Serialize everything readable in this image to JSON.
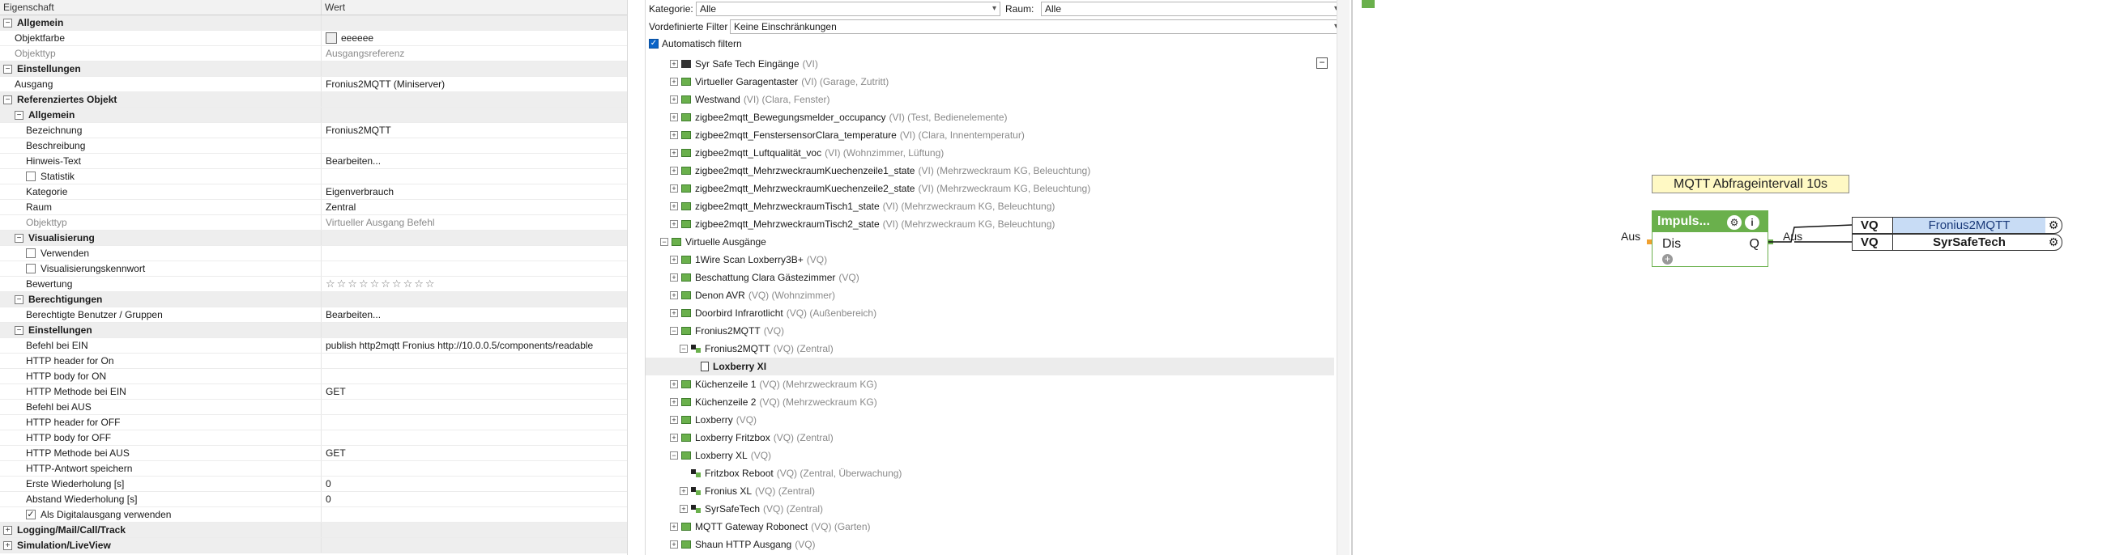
{
  "props": {
    "header": {
      "col1": "Eigenschaft",
      "col2": "Wert"
    },
    "rows": [
      {
        "kind": "cat",
        "level": 0,
        "label": "Allgemein",
        "value": ""
      },
      {
        "kind": "prop",
        "level": 1,
        "label": "Objektfarbe",
        "value": "eeeeee",
        "swatch": "#eeeeee"
      },
      {
        "kind": "prop",
        "level": 1,
        "label": "Objekttyp",
        "value": "Ausgangsreferenz",
        "dim": true
      },
      {
        "kind": "cat",
        "level": 0,
        "label": "Einstellungen",
        "value": ""
      },
      {
        "kind": "prop",
        "level": 1,
        "label": "Ausgang",
        "value": "Fronius2MQTT (Miniserver)"
      },
      {
        "kind": "cat",
        "level": 0,
        "label": "Referenziertes Objekt",
        "value": ""
      },
      {
        "kind": "cat",
        "level": 1,
        "label": "Allgemein",
        "value": ""
      },
      {
        "kind": "prop",
        "level": 2,
        "label": "Bezeichnung",
        "value": "Fronius2MQTT"
      },
      {
        "kind": "prop",
        "level": 2,
        "label": "Beschreibung",
        "value": ""
      },
      {
        "kind": "prop",
        "level": 2,
        "label": "Hinweis-Text",
        "value": "Bearbeiten..."
      },
      {
        "kind": "check",
        "level": 2,
        "label": "Statistik",
        "value": "",
        "checked": false
      },
      {
        "kind": "prop",
        "level": 2,
        "label": "Kategorie",
        "value": "Eigenverbrauch"
      },
      {
        "kind": "prop",
        "level": 2,
        "label": "Raum",
        "value": "Zentral"
      },
      {
        "kind": "prop",
        "level": 2,
        "label": "Objekttyp",
        "value": "Virtueller Ausgang Befehl",
        "dim": true
      },
      {
        "kind": "cat",
        "level": 1,
        "label": "Visualisierung",
        "value": ""
      },
      {
        "kind": "check",
        "level": 2,
        "label": "Verwenden",
        "value": "",
        "checked": false
      },
      {
        "kind": "check",
        "level": 2,
        "label": "Visualisierungskennwort",
        "value": "",
        "checked": false
      },
      {
        "kind": "prop",
        "level": 2,
        "label": "Bewertung",
        "value": "☆☆☆☆☆☆☆☆☆☆",
        "stars": true
      },
      {
        "kind": "cat",
        "level": 1,
        "label": "Berechtigungen",
        "value": ""
      },
      {
        "kind": "prop",
        "level": 2,
        "label": "Berechtigte Benutzer / Gruppen",
        "value": "Bearbeiten..."
      },
      {
        "kind": "cat",
        "level": 1,
        "label": "Einstellungen",
        "value": ""
      },
      {
        "kind": "prop",
        "level": 2,
        "label": "Befehl bei EIN",
        "value": "publish http2mqtt Fronius http://10.0.0.5/components/readable"
      },
      {
        "kind": "prop",
        "level": 2,
        "label": "HTTP header for On",
        "value": ""
      },
      {
        "kind": "prop",
        "level": 2,
        "label": "HTTP body for ON",
        "value": ""
      },
      {
        "kind": "prop",
        "level": 2,
        "label": "HTTP Methode bei EIN",
        "value": "GET"
      },
      {
        "kind": "prop",
        "level": 2,
        "label": "Befehl bei AUS",
        "value": ""
      },
      {
        "kind": "prop",
        "level": 2,
        "label": "HTTP header for OFF",
        "value": ""
      },
      {
        "kind": "prop",
        "level": 2,
        "label": "HTTP body for OFF",
        "value": ""
      },
      {
        "kind": "prop",
        "level": 2,
        "label": "HTTP Methode bei AUS",
        "value": "GET"
      },
      {
        "kind": "prop",
        "level": 2,
        "label": "HTTP-Antwort speichern",
        "value": ""
      },
      {
        "kind": "prop",
        "level": 2,
        "label": "Erste Wiederholung [s]",
        "value": "0"
      },
      {
        "kind": "prop",
        "level": 2,
        "label": "Abstand Wiederholung [s]",
        "value": "0"
      },
      {
        "kind": "check",
        "level": 2,
        "label": "Als Digitalausgang verwenden",
        "value": "",
        "checked": true
      },
      {
        "kind": "cat",
        "level": 0,
        "label": "Logging/Mail/Call/Track",
        "value": "",
        "collapsed": true
      },
      {
        "kind": "cat",
        "level": 0,
        "label": "Simulation/LiveView",
        "value": "",
        "collapsed": true
      }
    ]
  },
  "tree": {
    "filters": {
      "kategorie_label": "Kategorie:",
      "kategorie_value": "Alle",
      "raum_label": "Raum:",
      "raum_value": "Alle",
      "vordef_label": "Vordefinierte Filter",
      "vordef_value": "Keine Einschränkungen",
      "auto_label": "Automatisch filtern"
    },
    "items": [
      {
        "level": 1,
        "exp": "+",
        "icon": "dark",
        "name": "Syr Safe Tech Eingänge",
        "meta": "(VI)"
      },
      {
        "level": 1,
        "exp": "+",
        "icon": "green",
        "name": "Virtueller Garagentaster",
        "meta": "(VI) (Garage, Zutritt)"
      },
      {
        "level": 1,
        "exp": "+",
        "icon": "green",
        "name": "Westwand",
        "meta": "(VI) (Clara, Fenster)"
      },
      {
        "level": 1,
        "exp": "+",
        "icon": "green",
        "name": "zigbee2mqtt_Bewegungsmelder_occupancy",
        "meta": "(VI) (Test, Bedienelemente)"
      },
      {
        "level": 1,
        "exp": "+",
        "icon": "green",
        "name": "zigbee2mqtt_FenstersensorClara_temperature",
        "meta": "(VI) (Clara, Innentemperatur)"
      },
      {
        "level": 1,
        "exp": "+",
        "icon": "green",
        "name": "zigbee2mqtt_Luftqualität_voc",
        "meta": "(VI) (Wohnzimmer, Lüftung)"
      },
      {
        "level": 1,
        "exp": "+",
        "icon": "green",
        "name": "zigbee2mqtt_MehrzweckraumKuechenzeile1_state",
        "meta": "(VI) (Mehrzweckraum KG, Beleuchtung)"
      },
      {
        "level": 1,
        "exp": "+",
        "icon": "green",
        "name": "zigbee2mqtt_MehrzweckraumKuechenzeile2_state",
        "meta": "(VI) (Mehrzweckraum KG, Beleuchtung)"
      },
      {
        "level": 1,
        "exp": "+",
        "icon": "green",
        "name": "zigbee2mqtt_MehrzweckraumTisch1_state",
        "meta": "(VI) (Mehrzweckraum KG, Beleuchtung)"
      },
      {
        "level": 1,
        "exp": "+",
        "icon": "green",
        "name": "zigbee2mqtt_MehrzweckraumTisch2_state",
        "meta": "(VI) (Mehrzweckraum KG, Beleuchtung)"
      },
      {
        "level": 0,
        "exp": "−",
        "icon": "green",
        "name": "Virtuelle Ausgänge",
        "meta": ""
      },
      {
        "level": 1,
        "exp": "+",
        "icon": "green",
        "name": "1Wire Scan Loxberry3B+",
        "meta": "(VQ)"
      },
      {
        "level": 1,
        "exp": "+",
        "icon": "green",
        "name": "Beschattung Clara Gästezimmer",
        "meta": "(VQ)"
      },
      {
        "level": 1,
        "exp": "+",
        "icon": "green",
        "name": "Denon AVR",
        "meta": "(VQ) (Wohnzimmer)"
      },
      {
        "level": 1,
        "exp": "+",
        "icon": "green",
        "name": "Doorbird Infrarotlicht",
        "meta": "(VQ) (Außenbereich)"
      },
      {
        "level": 1,
        "exp": "−",
        "icon": "green",
        "name": "Fronius2MQTT",
        "meta": "(VQ)"
      },
      {
        "level": 2,
        "exp": "−",
        "icon": "plug",
        "name": "Fronius2MQTT",
        "meta": "(VQ) (Zentral)"
      },
      {
        "level": 3,
        "exp": "",
        "icon": "doc",
        "name": "Loxberry XI",
        "meta": "",
        "bold": true,
        "hl": true
      },
      {
        "level": 1,
        "exp": "+",
        "icon": "green",
        "name": "Küchenzeile 1",
        "meta": "(VQ) (Mehrzweckraum KG)"
      },
      {
        "level": 1,
        "exp": "+",
        "icon": "green",
        "name": "Küchenzeile 2",
        "meta": "(VQ) (Mehrzweckraum KG)"
      },
      {
        "level": 1,
        "exp": "+",
        "icon": "green",
        "name": "Loxberry",
        "meta": "(VQ)"
      },
      {
        "level": 1,
        "exp": "+",
        "icon": "green",
        "name": "Loxberry Fritzbox",
        "meta": "(VQ) (Zentral)"
      },
      {
        "level": 1,
        "exp": "−",
        "icon": "green",
        "name": "Loxberry XL",
        "meta": "(VQ)"
      },
      {
        "level": 2,
        "exp": "",
        "icon": "plug",
        "name": "Fritzbox Reboot",
        "meta": "(VQ) (Zentral, Überwachung)"
      },
      {
        "level": 2,
        "exp": "+",
        "icon": "plug",
        "name": "Fronius XL",
        "meta": "(VQ) (Zentral)"
      },
      {
        "level": 2,
        "exp": "+",
        "icon": "plug",
        "name": "SyrSafeTech",
        "meta": "(VQ) (Zentral)"
      },
      {
        "level": 1,
        "exp": "+",
        "icon": "green",
        "name": "MQTT Gateway Robonect",
        "meta": "(VQ) (Garten)"
      },
      {
        "level": 1,
        "exp": "+",
        "icon": "green",
        "name": "Shaun HTTP Ausgang",
        "meta": "(VQ)"
      }
    ]
  },
  "canvas": {
    "comment": "MQTT Abfrageintervall 10s",
    "block": {
      "title": "Impuls...",
      "input_dis": "Dis",
      "output_q": "Q",
      "gear_icon": "⚙",
      "info_icon": "i",
      "add_icon": "+"
    },
    "left_label": "Aus",
    "right_label": "Aus",
    "outputs": [
      {
        "type": "VQ",
        "name": "Fronius2MQTT",
        "selected": true
      },
      {
        "type": "VQ",
        "name": "SyrSafeTech",
        "selected": false
      }
    ],
    "accent_green": "#6ab04c",
    "pin_orange": "#f0a030"
  }
}
